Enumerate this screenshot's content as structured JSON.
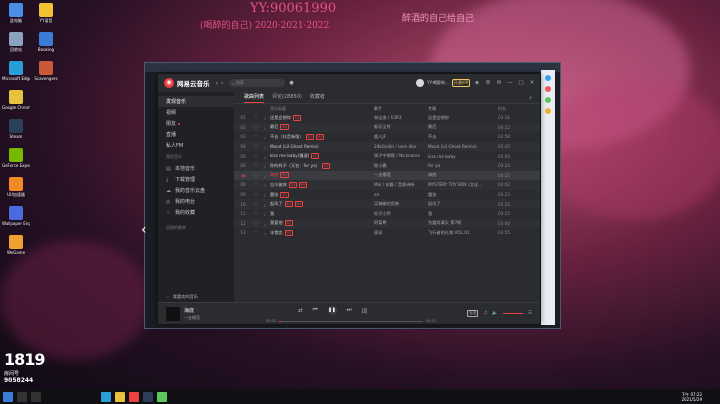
{
  "overlay": {
    "line1": "YY:90061990",
    "line2": "(喝醉的自己) 2020·2021·2022",
    "line3": "醉酒的自己给自己",
    "watermark_big": "1819",
    "watermark_small": "房间号",
    "watermark_num": "9058244"
  },
  "desktop_icons": [
    {
      "label": "此电脑",
      "color": "#4a8ee8"
    },
    {
      "label": "回收站",
      "color": "#8aa4c0"
    },
    {
      "label": "Microsoft Edge",
      "color": "#2a9ed8"
    },
    {
      "label": "Google Chrome",
      "color": "#e8c23a"
    },
    {
      "label": "Steam",
      "color": "#2a3f5a"
    },
    {
      "label": "GeForce Experience",
      "color": "#76b900"
    },
    {
      "label": "UU加速器",
      "color": "#f08a24"
    },
    {
      "label": "Wallpaper Engine",
      "color": "#4a6ae0"
    },
    {
      "label": "WeGame",
      "color": "#f0a030"
    },
    {
      "label": "YY语音",
      "color": "#f2c230"
    },
    {
      "label": "Booking",
      "color": "#3a7cd8"
    },
    {
      "label": "Scavengers",
      "color": "#c85a3a"
    }
  ],
  "app": {
    "name": "网易云音乐",
    "search_placeholder": "搜索",
    "user_name": "YY:喝醉的...",
    "vip_label": "开通VIP",
    "sidebar": {
      "items": [
        {
          "label": "发现音乐",
          "icon": "music-icon",
          "active": true
        },
        {
          "label": "视频",
          "icon": "video-icon",
          "active": false
        },
        {
          "label": "朋友",
          "icon": "friends-icon",
          "active": false
        },
        {
          "label": "直播",
          "icon": "live-icon",
          "active": false
        },
        {
          "label": "私人FM",
          "icon": "radio-icon",
          "active": false
        }
      ],
      "section_my": "我的音乐",
      "my_items": [
        {
          "label": "本地音乐",
          "icon": "folder-icon"
        },
        {
          "label": "下载管理",
          "icon": "download-icon"
        },
        {
          "label": "我的音乐云盘",
          "icon": "cloud-icon"
        },
        {
          "label": "我的电台",
          "icon": "radio-station-icon"
        },
        {
          "label": "我的收藏",
          "icon": "star-icon"
        }
      ],
      "section_created": "创建的歌单",
      "footer": "我喜欢的音乐"
    },
    "tabs": [
      {
        "label": "歌曲列表",
        "active": true
      },
      {
        "label": "评论(28850)",
        "active": false
      },
      {
        "label": "收藏者",
        "active": false
      }
    ],
    "columns": {
      "title": "音乐标题",
      "artist": "歌手",
      "album": "专辑",
      "time": "时长"
    },
    "songs": [
      {
        "idx": "01",
        "title": "还是会想你",
        "tags": [
          "SQ"
        ],
        "artist": "林达浪 / h3R3",
        "album": "还是会想你",
        "time": "03:16"
      },
      {
        "idx": "02",
        "title": "最后",
        "tags": [
          "SQ"
        ],
        "artist": "新乐尘符",
        "album": "最后",
        "time": "04:12"
      },
      {
        "idx": "03",
        "title": "不去（抖音新版）",
        "tags": [
          "SQ",
          "MV"
        ],
        "artist": "鹿人JF",
        "album": "不去",
        "time": "02:58"
      },
      {
        "idx": "04",
        "title": "Mood (Lil Ghost Remix)",
        "tags": [],
        "artist": "24kGoldn / iann dior",
        "album": "Mood (Lil Ghost Remix)",
        "time": "02:45"
      },
      {
        "idx": "05",
        "title": "kiss me baby(慢速)",
        "tags": [
          "SQ"
        ],
        "artist": "周子宇嗯嗯 / Nickname",
        "album": "kiss me baby",
        "time": "03:04"
      },
      {
        "idx": "06",
        "title": "你的样子（又名：for ya）",
        "tags": [
          "SQ"
        ],
        "artist": "陈小春",
        "album": "for ya",
        "time": "03:24"
      },
      {
        "idx": "07",
        "title": "海底",
        "tags": [
          "SQ"
        ],
        "artist": "一支榴莲",
        "album": "海底",
        "time": "04:15",
        "playing": true
      },
      {
        "idx": "08",
        "title": "忘川彼岸",
        "tags": [
          "SQ",
          "MV"
        ],
        "artist": "Mai / 玄觞 / 音阙诗听",
        "album": "MYSTERY TOY BOX (文化...",
        "time": "04:02"
      },
      {
        "idx": "09",
        "title": "嚣张",
        "tags": [
          "SQ"
        ],
        "artist": "en",
        "album": "嚣张",
        "time": "03:23"
      },
      {
        "idx": "10",
        "title": "起风了",
        "tags": [
          "SQ",
          "MV"
        ],
        "artist": "买辣椒也用券",
        "album": "起风了",
        "time": "05:25"
      },
      {
        "idx": "11",
        "title": "我",
        "tags": [],
        "artist": "旺仔小乔",
        "album": "我",
        "time": "03:12"
      },
      {
        "idx": "12",
        "title": "我爱他",
        "tags": [
          "SQ"
        ],
        "artist": "阿梨粤",
        "album": "为霞尚满天 第7期",
        "time": "03:40"
      },
      {
        "idx": "13",
        "title": "冰雪恋",
        "tags": [
          "SQ"
        ],
        "artist": "周深",
        "album": "飞行者的礼物 VOL.01",
        "time": "03:55"
      }
    ],
    "player": {
      "song": "海底",
      "artist": "一支榴莲",
      "current": "00:02",
      "total": "04:15",
      "progress": 0.01,
      "quality": "标准"
    }
  },
  "taskbar": {
    "time": "下午 07:22",
    "date": "2021/5/29"
  },
  "colors": {
    "accent": "#ec4141",
    "app_bg": "#232428",
    "sidebar_bg": "#202124"
  }
}
